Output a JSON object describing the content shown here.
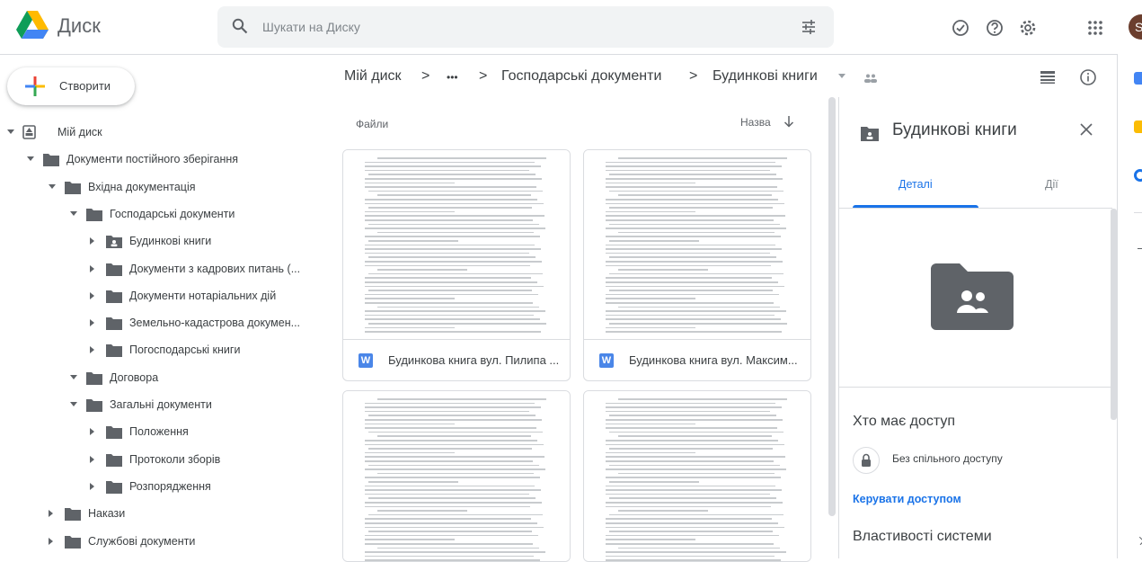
{
  "header": {
    "app_name": "Диск",
    "search_placeholder": "Шукати на Диску",
    "avatar_letter": "S",
    "icons": [
      "offline-icon",
      "help-icon",
      "settings-icon",
      "apps-grid-icon"
    ]
  },
  "sidebar": {
    "create_label": "Створити",
    "tree": [
      {
        "label": "Мій диск",
        "level": 0,
        "expanded": true,
        "icon": "drive-icon"
      },
      {
        "label": "Документи постійного зберігання",
        "level": 1,
        "expanded": true,
        "icon": "folder-icon"
      },
      {
        "label": "Вхідна документація",
        "level": 2,
        "expanded": true,
        "icon": "folder-icon"
      },
      {
        "label": "Господарські документи",
        "level": 3,
        "expanded": true,
        "icon": "folder-icon"
      },
      {
        "label": "Будинкові книги",
        "level": 4,
        "expanded": false,
        "icon": "shared-folder-icon"
      },
      {
        "label": "Документи з кадрових питань (...",
        "level": 4,
        "expanded": false,
        "icon": "folder-icon"
      },
      {
        "label": "Документи нотаріальних дій",
        "level": 4,
        "expanded": false,
        "icon": "folder-icon"
      },
      {
        "label": "Земельно-кадастрова докумен...",
        "level": 4,
        "expanded": false,
        "icon": "folder-icon"
      },
      {
        "label": "Погосподарські книги",
        "level": 4,
        "expanded": false,
        "icon": "folder-icon"
      },
      {
        "label": "Договора",
        "level": 3,
        "expanded": true,
        "icon": "folder-icon"
      },
      {
        "label": "Загальні документи",
        "level": 3,
        "expanded": true,
        "icon": "folder-icon"
      },
      {
        "label": "Положення",
        "level": 4,
        "expanded": false,
        "icon": "folder-icon"
      },
      {
        "label": "Протоколи зборів",
        "level": 4,
        "expanded": false,
        "icon": "folder-icon"
      },
      {
        "label": "Розпорядження",
        "level": 4,
        "expanded": false,
        "icon": "folder-icon"
      },
      {
        "label": "Накази",
        "level": 2,
        "expanded": false,
        "icon": "folder-icon"
      },
      {
        "label": "Службові документи",
        "level": 2,
        "expanded": false,
        "icon": "folder-icon"
      }
    ]
  },
  "breadcrumb": {
    "root": "Мій диск",
    "sep": ">",
    "ellipsis": "•••",
    "parent": "Господарські документи",
    "current": "Будинкові книги"
  },
  "files": {
    "section_title": "Файли",
    "sort_label": "Назва",
    "items": [
      {
        "name": "Будинкова книга вул. Пилипа ...",
        "type_icon": "W"
      },
      {
        "name": "Будинкова книга вул. Максим...",
        "type_icon": "W"
      },
      {
        "name": "",
        "type_icon": ""
      },
      {
        "name": "",
        "type_icon": ""
      }
    ]
  },
  "details": {
    "title": "Будинкові книги",
    "tab_details": "Деталі",
    "tab_activity": "Дії",
    "access_heading": "Хто має доступ",
    "no_sharing": "Без спільного доступу",
    "manage_access": "Керувати доступом",
    "system_props": "Властивості системи"
  },
  "colors": {
    "accent": "#1a73e8",
    "folder": "#5f6368",
    "word": "#4a86e8"
  }
}
